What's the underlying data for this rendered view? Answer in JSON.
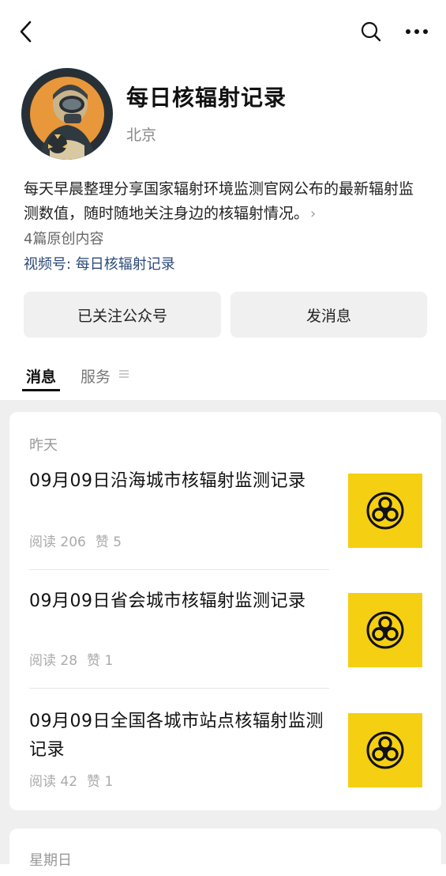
{
  "account": {
    "name": "每日核辐射记录",
    "location": "北京",
    "description": "每天早晨整理分享国家辐射环境监测官网公布的最新辐射监测数值，随时随地关注身边的核辐射情况。",
    "original_count": "4篇原创内容",
    "channel": "视频号: 每日核辐射记录"
  },
  "actions": {
    "follow_label": "已关注公众号",
    "message_label": "发消息"
  },
  "tabs": [
    {
      "label": "消息",
      "active": true
    },
    {
      "label": "服务",
      "active": false
    }
  ],
  "groups": [
    {
      "date": "昨天",
      "articles": [
        {
          "title": "09月09日沿海城市核辐射监测记录",
          "reads": "阅读 206",
          "likes": "赞 5"
        },
        {
          "title": "09月09日省会城市核辐射监测记录",
          "reads": "阅读 28",
          "likes": "赞 1"
        },
        {
          "title": "09月09日全国各城市站点核辐射监测记录",
          "reads": "阅读 42",
          "likes": "赞 1"
        }
      ]
    },
    {
      "date": "星期日",
      "articles": []
    }
  ],
  "icons": {
    "back": "chevron-left-icon",
    "search": "search-icon",
    "more": "more-dots-icon",
    "thumb": "biohazard-icon"
  },
  "colors": {
    "thumb_bg": "#f5cf12",
    "link": "#2c4a7a",
    "avatar_accent": "#e8973a"
  }
}
